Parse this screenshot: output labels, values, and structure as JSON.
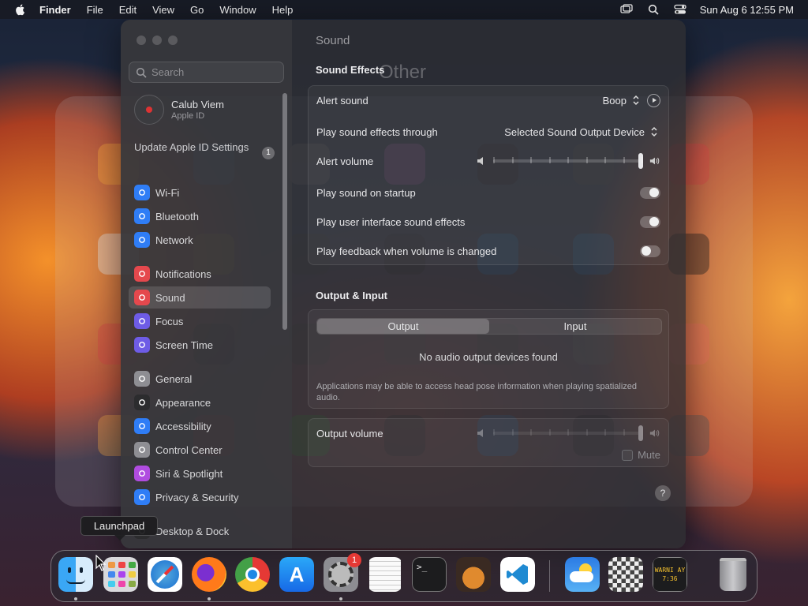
{
  "menubar": {
    "app_name": "Finder",
    "menus": [
      "File",
      "Edit",
      "View",
      "Go",
      "Window",
      "Help"
    ],
    "status_icons": [
      "screen-mirroring-icon",
      "spotlight-search-icon",
      "control-center-icon"
    ],
    "clock": "Sun Aug 6  12:55 PM"
  },
  "launchpad": {
    "folder_title": "Other",
    "tooltip": "Launchpad"
  },
  "window": {
    "search_placeholder": "Search",
    "account": {
      "name": "Calub Viem",
      "subtitle": "Apple ID"
    },
    "update_notice": {
      "label": "Update Apple ID Settings",
      "badge": "1"
    },
    "sidebar_items": [
      {
        "label": "Wi-Fi",
        "icon": "wifi-icon",
        "color": "#2f7df6"
      },
      {
        "label": "Bluetooth",
        "icon": "bluetooth-icon",
        "color": "#2f7df6"
      },
      {
        "label": "Network",
        "icon": "network-icon",
        "color": "#2f7df6"
      },
      {
        "label": "Notifications",
        "icon": "notifications-icon",
        "color": "#e5484d"
      },
      {
        "label": "Sound",
        "icon": "sound-icon",
        "color": "#e5484d"
      },
      {
        "label": "Focus",
        "icon": "focus-icon",
        "color": "#6e5ce6"
      },
      {
        "label": "Screen Time",
        "icon": "screen-time-icon",
        "color": "#6e5ce6"
      },
      {
        "label": "General",
        "icon": "general-icon",
        "color": "#8e8e93"
      },
      {
        "label": "Appearance",
        "icon": "appearance-icon",
        "color": "#2c2c2e"
      },
      {
        "label": "Accessibility",
        "icon": "accessibility-icon",
        "color": "#2f7df6"
      },
      {
        "label": "Control Center",
        "icon": "control-center-icon",
        "color": "#8e8e93"
      },
      {
        "label": "Siri & Spotlight",
        "icon": "siri-icon",
        "color": "#b04ce0"
      },
      {
        "label": "Privacy & Security",
        "icon": "privacy-icon",
        "color": "#2f7df6"
      },
      {
        "label": "Desktop & Dock",
        "icon": "desktop-dock-icon",
        "color": "#2c2c2e"
      }
    ],
    "pane_title": "Sound",
    "sound_effects": {
      "title": "Sound Effects",
      "alert_sound_label": "Alert sound",
      "alert_sound_value": "Boop",
      "output_through_label": "Play sound effects through",
      "output_through_value": "Selected Sound Output Device",
      "alert_volume_label": "Alert volume",
      "alert_volume_level": 1.0,
      "startup_label": "Play sound on startup",
      "startup_on": true,
      "ui_effects_label": "Play user interface sound effects",
      "ui_effects_on": true,
      "feedback_label": "Play feedback when volume is changed",
      "feedback_on": false
    },
    "output_input": {
      "title": "Output & Input",
      "tabs": [
        "Output",
        "Input"
      ],
      "active_tab": "Output",
      "empty_message": "No audio output devices found",
      "note": "Applications may be able to access head pose information when playing spatialized audio."
    },
    "output_volume": {
      "label": "Output volume",
      "level": 1.0,
      "mute_label": "Mute",
      "muted": false
    },
    "help": "?"
  },
  "dock": {
    "apps": [
      {
        "name": "Finder",
        "icon": "finder-icon",
        "running": true
      },
      {
        "name": "Launchpad",
        "icon": "launchpad-icon",
        "running": false
      },
      {
        "name": "Safari",
        "icon": "safari-icon",
        "running": false
      },
      {
        "name": "Firefox",
        "icon": "firefox-icon",
        "running": true
      },
      {
        "name": "Chrome",
        "icon": "chrome-icon",
        "running": false
      },
      {
        "name": "App Store",
        "icon": "app-store-icon",
        "running": false
      },
      {
        "name": "System Settings",
        "icon": "system-settings-icon",
        "running": true,
        "badge": "1"
      },
      {
        "name": "TextEdit",
        "icon": "textedit-icon",
        "running": false
      },
      {
        "name": "Terminal",
        "icon": "terminal-icon",
        "running": false
      },
      {
        "name": "GarageBand",
        "icon": "garageband-icon",
        "running": false
      },
      {
        "name": "VS Code",
        "icon": "vscode-icon",
        "running": false
      },
      {
        "name": "Weather",
        "icon": "weather-icon",
        "running": false
      },
      {
        "name": "Chess",
        "icon": "chess-icon",
        "running": false
      },
      {
        "name": "Console",
        "icon": "console-icon",
        "running": false,
        "label": "WARNI AY 7:36"
      },
      {
        "name": "Trash",
        "icon": "trash-icon",
        "running": false
      }
    ]
  }
}
